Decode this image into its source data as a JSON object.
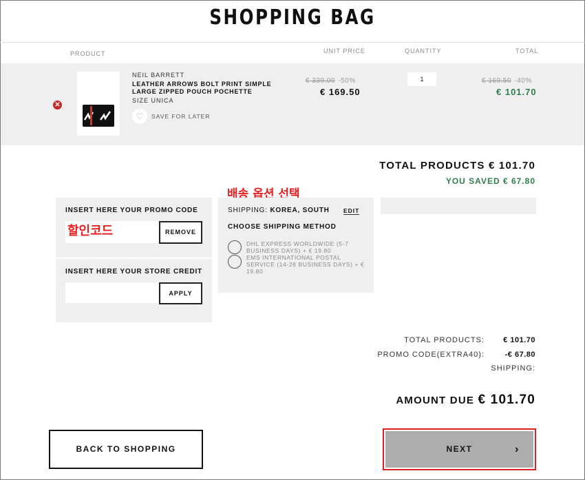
{
  "page": {
    "title": "SHOPPING BAG"
  },
  "columns": {
    "product": "PRODUCT",
    "unit_price": "UNIT PRICE",
    "quantity": "QUANTITY",
    "total": "TOTAL"
  },
  "item": {
    "brand": "NEIL BARRETT",
    "name": "LEATHER ARROWS BOLT PRINT SIMPLE LARGE ZIPPED POUCH POCHETTE",
    "size": "SIZE UNICA",
    "save_for_later": "SAVE FOR LATER",
    "unit_original": "€ 339.00",
    "unit_discount": "-50%",
    "unit_price": "€ 169.50",
    "quantity": "1",
    "total_original": "€ 169.50",
    "total_discount": "-40%",
    "total_price": "€ 101.70"
  },
  "totals": {
    "total_products": "TOTAL PRODUCTS € 101.70",
    "you_saved": "YOU SAVED € 67.80"
  },
  "annotations": {
    "shipping_option": "배송 옵션 선택",
    "promo_code": "할인코드"
  },
  "promo": {
    "title": "INSERT HERE YOUR PROMO CODE",
    "button": "REMOVE"
  },
  "store_credit": {
    "title": "INSERT HERE YOUR STORE CREDIT",
    "button": "APPLY"
  },
  "shipping": {
    "label": "SHIPPING:",
    "country": "KOREA, SOUTH",
    "edit": "EDIT",
    "method_title": "CHOOSE SHIPPING METHOD",
    "options": [
      "DHL EXPRESS WORLDWIDE (5-7 BUSINESS DAYS) + € 19.80",
      "EMS INTERNATIONAL POSTAL SERVICE (14-28 BUSINESS DAYS) + € 19.80"
    ]
  },
  "summary": {
    "rows": [
      {
        "label": "TOTAL PRODUCTS:",
        "value": "€ 101.70"
      },
      {
        "label": "PROMO CODE(EXTRA40):",
        "value": "-€ 67.80"
      },
      {
        "label": "SHIPPING:",
        "value": ""
      }
    ],
    "amount_due_label": "AMOUNT DUE",
    "amount_due_value": "€ 101.70"
  },
  "actions": {
    "back": "BACK TO SHOPPING",
    "next": "NEXT"
  },
  "colors": {
    "accent_green": "#2e7d4a",
    "highlight_red": "#e02020",
    "panel_gray": "#efefef"
  },
  "icons": {
    "remove": "close-circle-icon",
    "save": "heart-icon",
    "next": "chevron-right-icon"
  }
}
